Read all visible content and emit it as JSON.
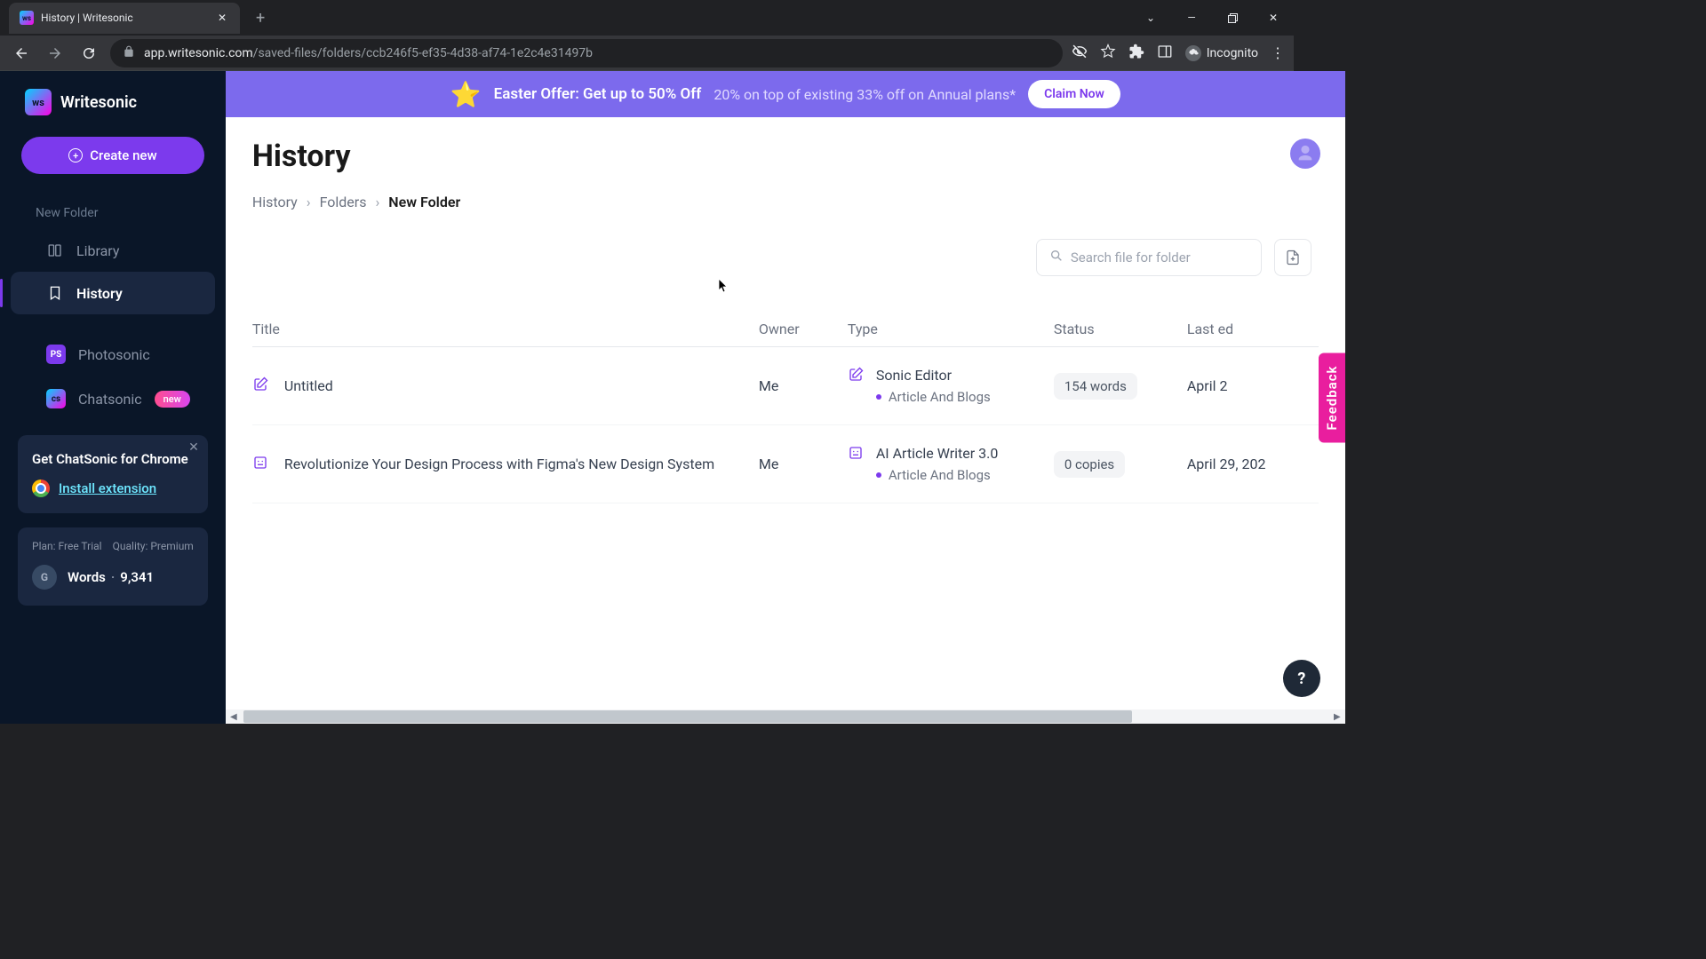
{
  "browser": {
    "tab_title": "History | Writesonic",
    "url_host": "app.writesonic.com",
    "url_path": "/saved-files/folders/ccb246f5-ef35-4d38-af74-1e2c4e31497b",
    "incognito_label": "Incognito"
  },
  "sidebar": {
    "brand": "Writesonic",
    "create_label": "Create new",
    "folder_label": "New Folder",
    "items": [
      {
        "label": "Library"
      },
      {
        "label": "History"
      },
      {
        "label": "Photosonic"
      },
      {
        "label": "Chatsonic",
        "badge": "new"
      }
    ],
    "promo": {
      "title": "Get ChatSonic for Chrome",
      "link_label": "Install extension"
    },
    "plan": {
      "plan_label": "Plan: Free Trial",
      "quality_label": "Quality: Premium",
      "words_label": "Words",
      "words_count": "9,341"
    }
  },
  "banner": {
    "bold": "Easter Offer: Get up to 50% Off",
    "light": "20% on top of existing 33% off on Annual plans*",
    "cta": "Claim Now"
  },
  "page": {
    "title": "History",
    "breadcrumb": [
      "History",
      "Folders",
      "New Folder"
    ],
    "search_placeholder": "Search file for folder",
    "feedback_label": "Feedback"
  },
  "table": {
    "headers": {
      "title": "Title",
      "owner": "Owner",
      "type": "Type",
      "status": "Status",
      "edited": "Last ed"
    },
    "rows": [
      {
        "title": "Untitled",
        "owner": "Me",
        "type_name": "Sonic Editor",
        "type_sub": "Article And Blogs",
        "status": "154 words",
        "edited": "April 2"
      },
      {
        "title": "Revolutionize Your Design Process with Figma's New Design System",
        "owner": "Me",
        "type_name": "AI Article Writer 3.0",
        "type_sub": "Article And Blogs",
        "status": "0 copies",
        "edited": "April 29, 202"
      }
    ]
  }
}
